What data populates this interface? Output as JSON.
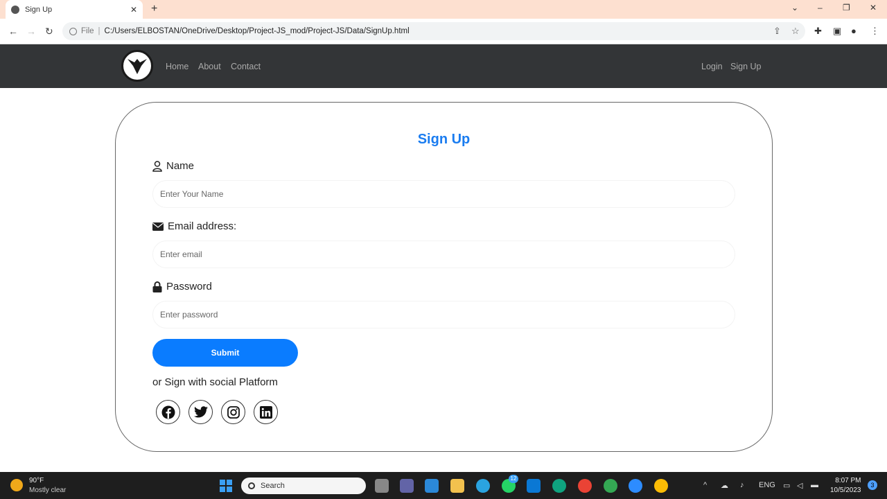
{
  "browser": {
    "tab_title": "Sign Up",
    "file_label": "File",
    "url": "C:/Users/ELBOSTAN/OneDrive/Desktop/Project-JS_mod/Project-JS/Data/SignUp.html"
  },
  "nav": {
    "links": [
      "Home",
      "About",
      "Contact"
    ],
    "login": "Login",
    "signup": "Sign Up"
  },
  "form": {
    "title": "Sign Up",
    "name_label": "Name",
    "name_placeholder": "Enter Your Name",
    "email_label": "Email address:",
    "email_placeholder": "Enter email",
    "password_label": "Password",
    "password_placeholder": "Enter password",
    "submit_label": "Submit",
    "social_text": "or Sign with social Platform",
    "social_icons": [
      "facebook-icon",
      "twitter-icon",
      "instagram-icon",
      "linkedin-icon"
    ]
  },
  "taskbar": {
    "temperature": "90°F",
    "condition": "Mostly clear",
    "search_placeholder": "Search",
    "whatsapp_badge": "12",
    "language": "ENG",
    "time": "8:07 PM",
    "date": "10/5/2023",
    "notifications": "3"
  },
  "colors": {
    "accent": "#1a7cf0",
    "button": "#0a7cff",
    "navbar": "#333537"
  }
}
